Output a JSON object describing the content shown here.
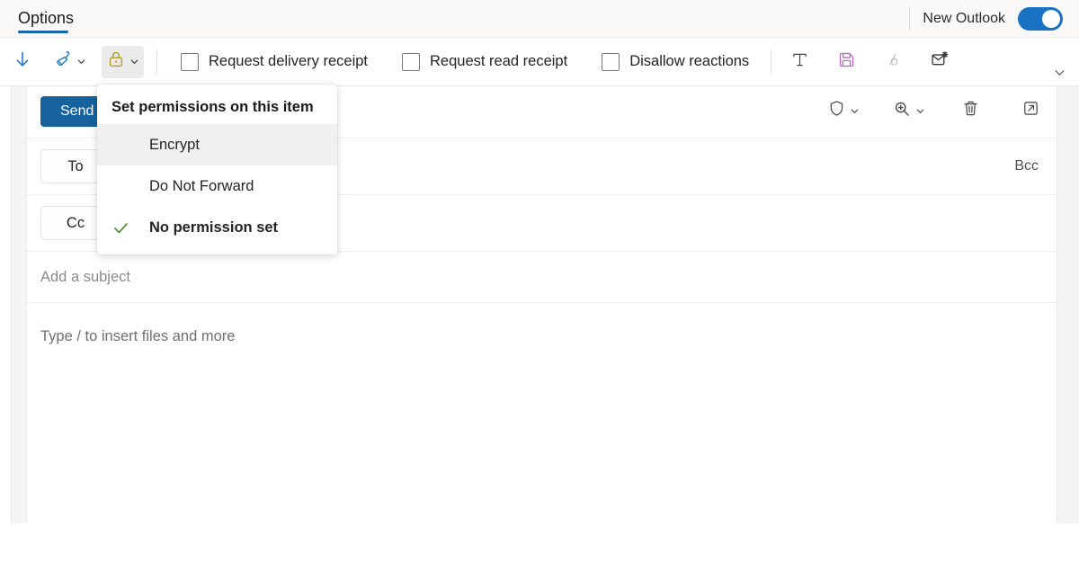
{
  "ribbon": {
    "tab_label": "Options",
    "accent_underline": "#1566ae",
    "new_outlook_label": "New Outlook",
    "toggle_on": true,
    "toggle_color": "#1a72c4"
  },
  "toolbar": {
    "items": [
      {
        "name": "download-arrow",
        "icon": "arrow-down-icon",
        "label": ""
      },
      {
        "name": "format-painter",
        "icon": "paint-brush-icon",
        "label": ""
      },
      {
        "name": "set-permissions",
        "icon": "lock-icon",
        "label": "",
        "active": true
      }
    ],
    "checkboxes": [
      {
        "label": "Request delivery receipt",
        "checked": false
      },
      {
        "label": "Request read receipt",
        "checked": false
      },
      {
        "label": "Disallow reactions",
        "checked": false
      }
    ],
    "trailing_icons": [
      {
        "name": "plain-text-icon",
        "glyph": "T",
        "color": "#444444"
      },
      {
        "name": "save-icon",
        "glyph": "save",
        "color": "#b56cc2"
      },
      {
        "name": "signature-icon",
        "glyph": "signature",
        "color": "#bdbdbd"
      },
      {
        "name": "mail-settings-icon",
        "glyph": "mail-gear",
        "color": "#3a3a3a"
      }
    ],
    "overflow_label": "chevron-down-icon"
  },
  "menu": {
    "header": "Set permissions on this item",
    "items": [
      {
        "label": "Encrypt",
        "checked": false,
        "hovered": true
      },
      {
        "label": "Do Not Forward",
        "checked": false,
        "hovered": false
      },
      {
        "label": "No permission set",
        "checked": true,
        "hovered": false
      }
    ],
    "check_color": "#4a8a32"
  },
  "compose": {
    "send_label": "Send",
    "send_color": "#15629d",
    "actions": [
      {
        "name": "sensitivity-shield",
        "icon": "shield-icon",
        "has_chevron": true
      },
      {
        "name": "zoom",
        "icon": "magnifier-plus-icon",
        "has_chevron": true
      },
      {
        "name": "discard",
        "icon": "trash-icon",
        "has_chevron": false
      },
      {
        "name": "pop-out",
        "icon": "open-in-new-window-icon",
        "has_chevron": false
      }
    ],
    "to_label": "To",
    "cc_label": "Cc",
    "bcc_label": "Bcc",
    "subject_placeholder": "Add a subject",
    "body_placeholder": "Type / to insert files and more"
  }
}
